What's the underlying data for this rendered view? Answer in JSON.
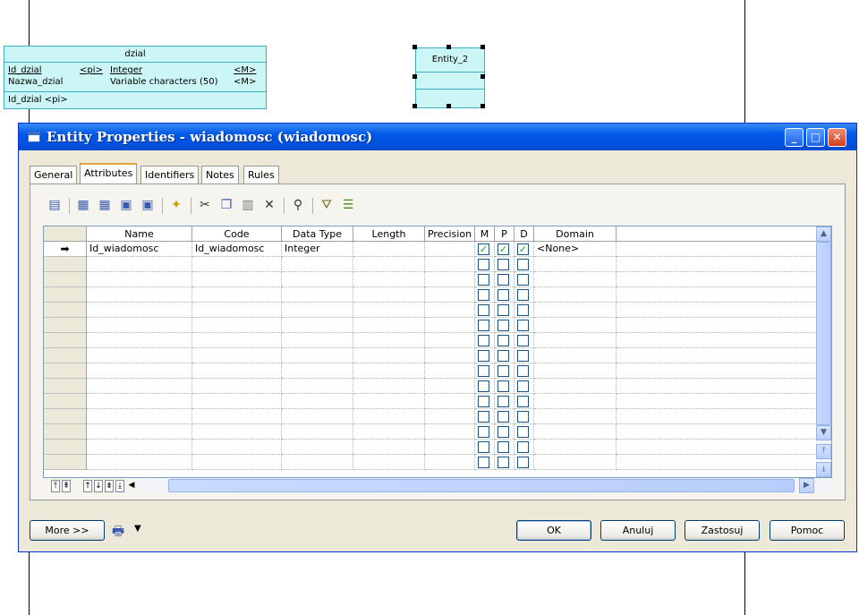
{
  "diagram": {
    "entity_dzial": {
      "title": "dzial",
      "attributes": [
        {
          "name": "Id_dzial",
          "key": "<pi>",
          "type": "Integer",
          "mandatory": "<M>"
        },
        {
          "name": "Nazwa_dzial",
          "key": "",
          "type": "Variable characters (50)",
          "mandatory": "<M>"
        }
      ],
      "identifier": "Id_dzial  <pi>"
    },
    "entity_2": {
      "title": "Entity_2"
    }
  },
  "window": {
    "title": "Entity Properties - wiadomosc (wiadomosc)",
    "tabs": [
      {
        "label": "General"
      },
      {
        "label": "Attributes"
      },
      {
        "label": "Identifiers"
      },
      {
        "label": "Notes"
      },
      {
        "label": "Rules"
      }
    ],
    "active_tab": "Attributes",
    "columns": [
      "Name",
      "Code",
      "Data Type",
      "Length",
      "Precision",
      "M",
      "P",
      "D",
      "Domain"
    ],
    "rows": [
      {
        "marker": "➡",
        "name": "Id_wiadomosc",
        "code": "Id_wiadomosc",
        "data_type": "Integer",
        "length": "",
        "precision": "",
        "m": true,
        "p": true,
        "d": true,
        "domain": "<None>"
      }
    ],
    "empty_rows": 14,
    "buttons": {
      "more": "More >>",
      "ok": "OK",
      "cancel": "Anuluj",
      "apply": "Zastosuj",
      "help": "Pomoc"
    }
  },
  "colors": {
    "title_bar": "#0058e6",
    "entity_fill": "#ccf5f5",
    "check": "#21a121"
  }
}
